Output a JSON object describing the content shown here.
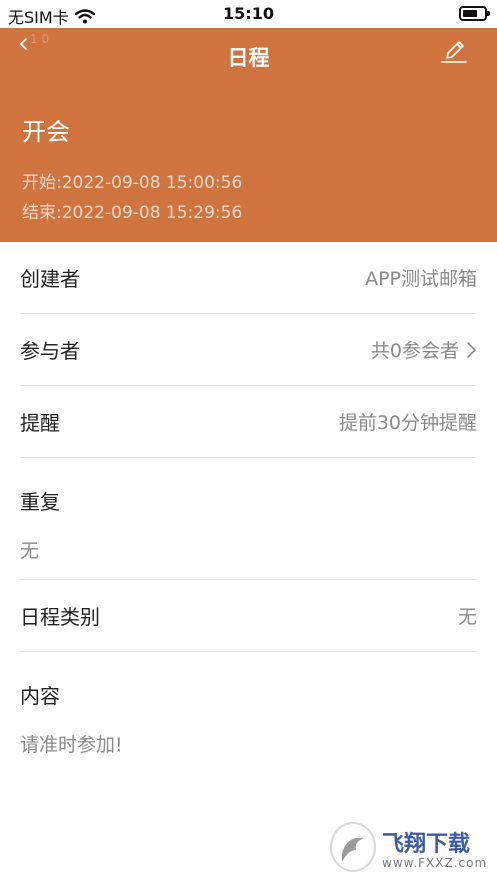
{
  "status": {
    "carrier": "无SIM卡",
    "time": "15:10"
  },
  "header": {
    "nav_title": "日程",
    "back_hint": "1 0",
    "event_title": "开会",
    "start_time": "开始:2022-09-08 15:00:56",
    "end_time": "结束:2022-09-08 15:29:56",
    "accent_color": "#d0743f"
  },
  "rows": {
    "creator": {
      "label": "创建者",
      "value": "APP测试邮箱"
    },
    "participants": {
      "label": "参与者",
      "value": "共0参会者"
    },
    "reminder": {
      "label": "提醒",
      "value": "提前30分钟提醒"
    },
    "repeat": {
      "label": "重复",
      "value": "无"
    },
    "category": {
      "label": "日程类别",
      "value": "无"
    },
    "content": {
      "label": "内容",
      "value": "请准时参加!"
    }
  },
  "watermark": {
    "brand": "飞翔下载",
    "url": "www.FXXZ.com"
  },
  "icons": {
    "back": "chevron-left-icon",
    "edit": "pencil-icon",
    "disclosure": "chevron-right-icon",
    "wifi": "wifi-icon",
    "battery": "battery-icon"
  }
}
